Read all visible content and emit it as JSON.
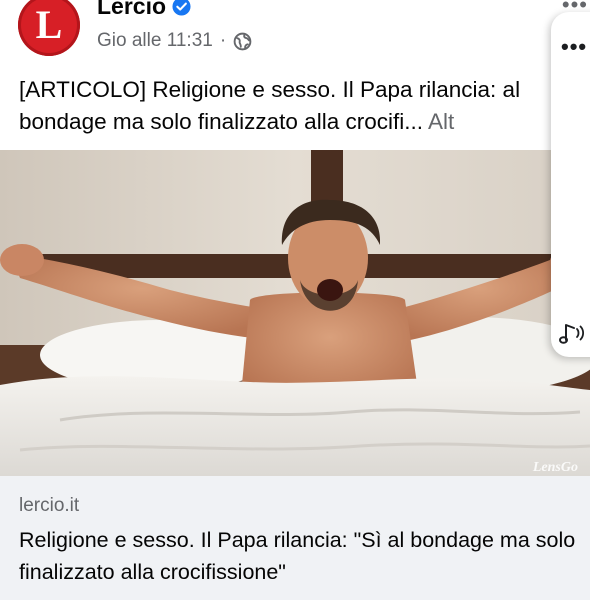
{
  "post": {
    "page_name": "Lercio",
    "logo_letter": "L",
    "verified_icon": "verified-badge-icon",
    "timestamp": "Gio alle 11:31",
    "separator": "·",
    "audience_icon": "globe-icon",
    "more_options": "•••",
    "text": "[ARTICOLO] Religione e sesso. Il Papa rilancia: al bondage ma solo finalizzato alla crocifi...",
    "see_more": "Alt"
  },
  "side_panel": {
    "dots": "•••",
    "music_icon": "music-note-icon"
  },
  "image": {
    "watermark": "LensGo"
  },
  "link_preview": {
    "domain": "lercio.it",
    "headline": "Religione e sesso. Il Papa rilancia: \"Sì al bondage ma solo finalizzato alla crocifissione\""
  },
  "colors": {
    "brand_red": "#d71f26",
    "verified_blue": "#1877f2",
    "secondary_text": "#65676b",
    "card_background": "#f0f2f5"
  }
}
